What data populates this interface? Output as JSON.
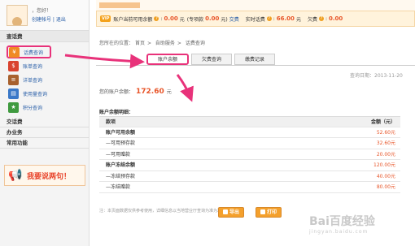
{
  "user": {
    "greeting": "，您好！",
    "links": "创建帐号 | 退出"
  },
  "sidebar": {
    "section_title": "查话费",
    "items": [
      {
        "label": "话费查询",
        "icon": "phone-bill-icon"
      },
      {
        "label": "账单查询",
        "icon": "bill-icon"
      },
      {
        "label": "详单查询",
        "icon": "detail-list-icon"
      },
      {
        "label": "使用量查询",
        "icon": "usage-icon"
      },
      {
        "label": "积分查询",
        "icon": "points-icon"
      }
    ],
    "sections": [
      "交话费",
      "办业务",
      "常用功能"
    ],
    "speak_label": "我要说两句！"
  },
  "topbar": {
    "vip": "VIP",
    "available_label": "账户当前可用余额",
    "available_value": "0.00",
    "yuan": "元",
    "special_label": "(专项款",
    "special_value": "0.00",
    "special_suffix": "元)",
    "pay_link": "交费",
    "realtime_label": "实时话费",
    "realtime_value": "66.00",
    "owe_label": "欠费",
    "owe_value": "0.00"
  },
  "breadcrumb": {
    "prefix": "您所在的位置：",
    "items": [
      "首页",
      "自助服务",
      "话费查询"
    ]
  },
  "tabs": [
    "账户余额",
    "欠费查询",
    "缴费记录"
  ],
  "query_date": "查询日期：2013-11-20",
  "balance": {
    "label": "您的账户余额：",
    "value": "172.60",
    "unit": "元"
  },
  "detail": {
    "title": "账户余额明细：",
    "headers": [
      "款项",
      "金额（元）"
    ],
    "rows": [
      {
        "name": "账户可用余额",
        "amount": "52.60元",
        "bold": true
      },
      {
        "name": "—可用预存款",
        "amount": "32.60元",
        "bold": false
      },
      {
        "name": "—可用赠款",
        "amount": "20.00元",
        "bold": false
      },
      {
        "name": "账户冻结余额",
        "amount": "120.00元",
        "bold": true
      },
      {
        "name": "—冻结预存款",
        "amount": "40.00元",
        "bold": false
      },
      {
        "name": "—冻结赠款",
        "amount": "80.00元",
        "bold": false
      }
    ]
  },
  "note": "注：本页面数据仅供参考使用，详细信息以当地营业厅查询为准为准。",
  "buttons": {
    "export": "导出",
    "print": "打印"
  },
  "watermark": {
    "brand": "Bai百度经验",
    "url": "jingyan.baidu.com"
  },
  "colors": {
    "accent": "#e8562a",
    "highlight_box": "#e8327a",
    "link": "#2a5fa8"
  }
}
